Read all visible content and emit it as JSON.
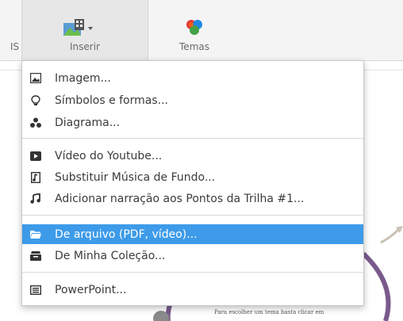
{
  "toolbar": {
    "left_label": "IS",
    "insert_label": "Inserir",
    "themes_label": "Temas"
  },
  "menu": {
    "items": [
      {
        "label": "Imagem...",
        "icon": "image-icon"
      },
      {
        "label": "Símbolos e formas...",
        "icon": "lightbulb-icon"
      },
      {
        "label": "Diagrama...",
        "icon": "diagram-icon"
      },
      {
        "label": "Vídeo do Youtube...",
        "icon": "play-icon"
      },
      {
        "label": "Substituir Música de Fundo...",
        "icon": "music-file-icon"
      },
      {
        "label": "Adicionar narração aos Pontos da Trilha #1...",
        "icon": "music-note-icon"
      },
      {
        "label": "De arquivo (PDF, vídeo)...",
        "icon": "folder-icon",
        "selected": true
      },
      {
        "label": "De Minha Coleção...",
        "icon": "collection-icon"
      },
      {
        "label": "PowerPoint...",
        "icon": "powerpoint-icon"
      }
    ]
  },
  "canvas": {
    "caption": "Para escolher um tema basta clicar em"
  },
  "colors": {
    "highlight": "#3d9be9",
    "accent_purple": "#7a5a8c"
  }
}
